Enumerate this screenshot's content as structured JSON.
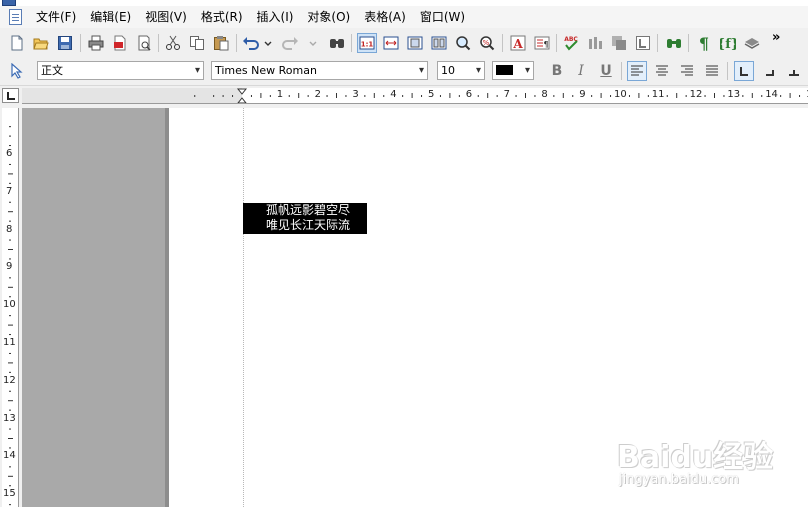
{
  "menu": {
    "items": [
      "文件(F)",
      "编辑(E)",
      "视图(V)",
      "格式(R)",
      "插入(I)",
      "对象(O)",
      "表格(A)",
      "窗口(W)"
    ]
  },
  "toolbar": {
    "overflow_label": "»",
    "icons": [
      "new-doc-icon",
      "open-folder-icon",
      "save-icon",
      "print-icon",
      "export-pdf-icon",
      "print-preview-icon",
      "cut-icon",
      "copy-icon",
      "paste-icon",
      "undo-icon",
      "redo-icon",
      "find-icon",
      "actual-size-icon",
      "page-width-icon",
      "single-page-icon",
      "two-page-icon",
      "zoom-icon",
      "zoom-percent-icon",
      "text-color-icon",
      "paragraph-icon",
      "spellcheck-icon",
      "column-chart-icon",
      "object-icon",
      "text-frame-icon",
      "replace-icon",
      "paragraph-mark-icon",
      "field-icon",
      "layer-icon"
    ]
  },
  "format_toolbar": {
    "style_value": "正文",
    "font_value": "Times New Roman",
    "size_value": "10",
    "color_value": "#000000",
    "bold_label": "B",
    "italic_label": "I",
    "underline_label": "U"
  },
  "ruler": {
    "h_labels": [
      "1",
      "2",
      "3",
      "4",
      "5",
      "6",
      "7",
      "8",
      "9",
      "10",
      "11",
      "12",
      "13",
      "14",
      "1"
    ],
    "v_labels": [
      "6",
      "7",
      "8",
      "9",
      "10",
      "11",
      "12",
      "13",
      "14",
      "15"
    ]
  },
  "document": {
    "lines": [
      "孤帆远影碧空尽",
      "唯见长江天际流"
    ]
  },
  "watermark": {
    "main": "Baidu经验",
    "sub": "jingyan.baidu.com"
  }
}
